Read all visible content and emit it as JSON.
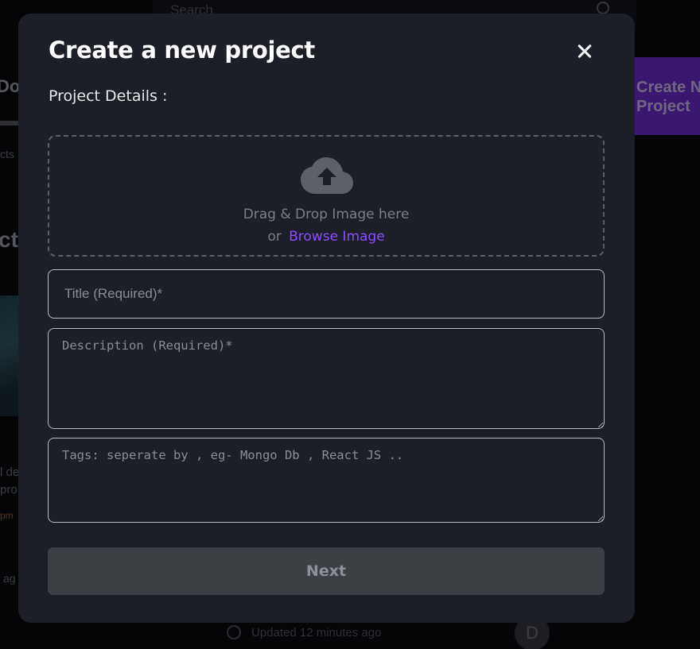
{
  "background": {
    "search_placeholder": "Search",
    "create_button_label": "Create New Project",
    "left_partial_1": "Do",
    "left_partial_2": "cts",
    "left_partial_3": "ct",
    "left_partial_4": "l de",
    "left_partial_5": "pro",
    "left_partial_6": "pm",
    "left_partial_7": "ag",
    "updated_text": "Updated 12 minutes ago",
    "avatar_initial": "D"
  },
  "modal": {
    "title": "Create a new project",
    "section_label": "Project Details :",
    "dropzone": {
      "text": "Drag & Drop Image here",
      "or_text": "or",
      "browse_label": "Browse Image",
      "icon": "cloud-upload-icon"
    },
    "title_field": {
      "placeholder": "Title (Required)*",
      "value": ""
    },
    "description_field": {
      "placeholder": "Description (Required)*",
      "value": ""
    },
    "tags_field": {
      "placeholder": "Tags: seperate by , eg- Mongo Db , React JS ..",
      "value": ""
    },
    "next_label": "Next",
    "close_icon": "close-icon"
  },
  "colors": {
    "modal_bg": "#1c1f27",
    "accent": "#8b4dff",
    "next_button_bg": "#3c4045",
    "field_border": "#b9bcc3"
  }
}
